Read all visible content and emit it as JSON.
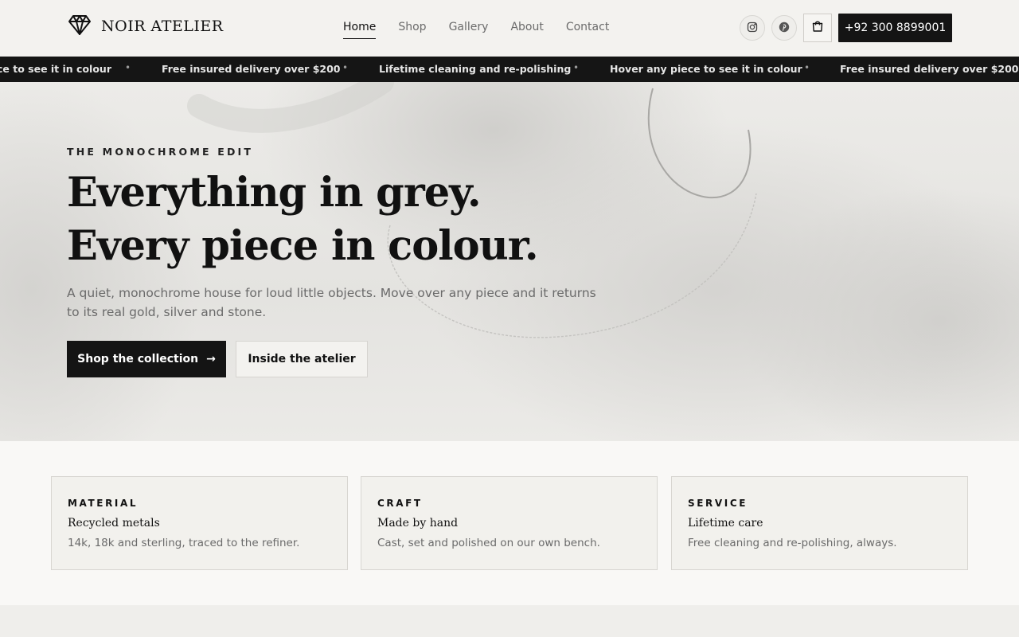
{
  "brand": {
    "name": "NOIR ATELIER",
    "logo_icon": "diamond-icon"
  },
  "nav": {
    "items": [
      {
        "label": "Home",
        "active": true
      },
      {
        "label": "Shop",
        "active": false
      },
      {
        "label": "Gallery",
        "active": false
      },
      {
        "label": "About",
        "active": false
      },
      {
        "label": "Contact",
        "active": false
      }
    ]
  },
  "header_actions": {
    "social_icons": [
      "instagram-icon",
      "pinterest-icon"
    ],
    "cart_icon": "shopping-bag-icon",
    "phone_label": "+92 300 8899001"
  },
  "marquee": {
    "items": [
      "ce to see it in colour",
      "Free insured delivery over $200",
      "Lifetime cleaning and re-polishing",
      "Hover any piece to see it in colour",
      "Free insured delivery over $200"
    ],
    "separator": "•"
  },
  "hero": {
    "eyebrow": "THE MONOCHROME EDIT",
    "headline": "Everything in grey. Every piece in colour.",
    "subtext": "A quiet, monochrome house for loud little objects. Move over any piece and it returns to its real gold, silver and stone.",
    "primary_cta": "Shop the collection",
    "primary_cta_arrow": "→",
    "secondary_cta": "Inside the atelier"
  },
  "features": [
    {
      "eyebrow": "MATERIAL",
      "title": "Recycled metals",
      "text": "14k, 18k and sterling, traced to the refiner."
    },
    {
      "eyebrow": "CRAFT",
      "title": "Made by hand",
      "text": "Cast, set and polished on our own bench."
    },
    {
      "eyebrow": "SERVICE",
      "title": "Lifetime care",
      "text": "Free cleaning and re-polishing, always."
    }
  ],
  "colors": {
    "accent": "#141414",
    "background": "#f2f1ee",
    "muted_text": "#6a6a6a"
  }
}
